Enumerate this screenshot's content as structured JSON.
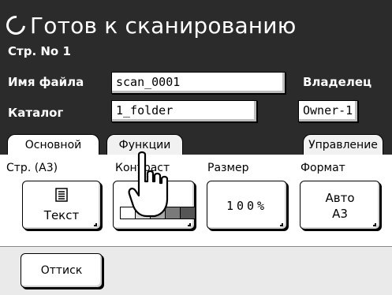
{
  "header": {
    "title": "Готов к сканированию",
    "page_label": "Стр. No 1",
    "filename_label": "Имя файла",
    "filename_value": "scan_0001",
    "catalog_label": "Каталог",
    "catalog_value": "1_folder",
    "owner_label": "Владелец",
    "owner_value": "Owner-1"
  },
  "tabs": [
    {
      "label": "Основной",
      "active": true
    },
    {
      "label": "Функции",
      "active": false
    },
    {
      "label": "Управление",
      "active": false
    }
  ],
  "sections": {
    "page_label": "Стр. (A3)",
    "contrast_label": "Контраст",
    "size_label": "Размер",
    "format_label": "Формат"
  },
  "buttons": {
    "text_mode": "Текст",
    "contrast_value": "",
    "size_value": "100%",
    "format_line1": "Авто",
    "format_line2": "A3",
    "proof": "Оттиск"
  },
  "contrast_levels": 5,
  "contrast_selected": 3,
  "icons": {
    "title": "scanner-ready-icon",
    "text_mode": "document-text-icon",
    "pointer": "hand-pointer-icon"
  },
  "colors": {
    "header_bg": "#2b2b2b",
    "bottom_bg": "#eaeaea",
    "text_on_dark": "#ffffff"
  }
}
